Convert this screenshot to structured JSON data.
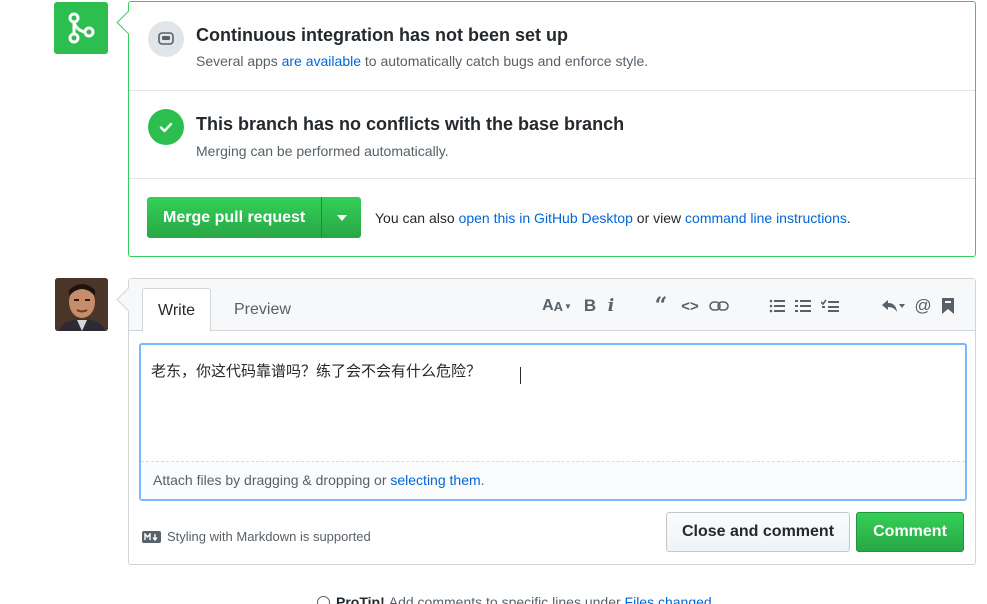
{
  "merge_box": {
    "ci": {
      "title": "Continuous integration has not been set up",
      "sub_prefix": "Several apps",
      "sub_link": "are available",
      "sub_suffix": "to automatically catch bugs and enforce style."
    },
    "conflicts": {
      "title": "This branch has no conflicts with the base branch",
      "sub": "Merging can be performed automatically."
    },
    "merge_button": "Merge pull request",
    "note_prefix": "You can also",
    "note_link1": "open this in GitHub Desktop",
    "note_middle": "or view",
    "note_link2": "command line instructions",
    "note_suffix": "."
  },
  "comment": {
    "tabs": [
      "Write",
      "Preview"
    ],
    "toolbar_icons": [
      "header-icon",
      "bold-icon",
      "italic-icon",
      "quote-icon",
      "code-icon",
      "link-icon",
      "unordered-list-icon",
      "ordered-list-icon",
      "task-list-icon",
      "reply-icon",
      "mention-icon",
      "bookmark-icon"
    ],
    "text_value": "老东，你这代码靠谱吗？练了会不会有什么危险？",
    "attach_prefix": "Attach files by dragging & dropping or",
    "attach_link": "selecting them",
    "attach_suffix": ".",
    "markdown_note": "Styling with Markdown is supported",
    "close_button": "Close and comment",
    "comment_button": "Comment"
  },
  "protip": {
    "label": "ProTip!",
    "text": "Add comments to specific lines under",
    "link": "Files changed"
  },
  "colors": {
    "green": "#2cbe4e",
    "link": "#0366d6",
    "focus_border": "#79b8ff"
  }
}
